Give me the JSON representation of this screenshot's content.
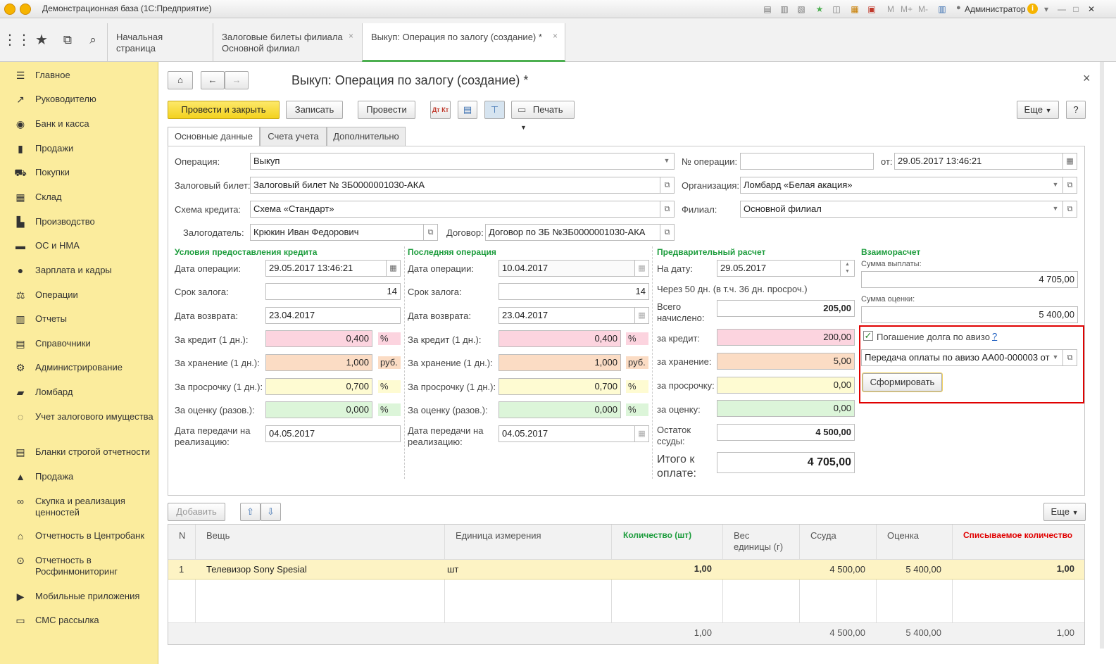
{
  "window": {
    "title": "Демонстрационная база (1С:Предприятие)",
    "user": "Администратор",
    "tb_m": "M",
    "tb_mplus": "M+",
    "tb_mminus": "M-"
  },
  "top_tabs": [
    {
      "line1": "Начальная страница",
      "line2": ""
    },
    {
      "line1": "Залоговые билеты филиала",
      "line2": "Основной филиал"
    },
    {
      "line1": "Выкуп: Операция по залогу (создание) *",
      "line2": ""
    }
  ],
  "sidebar": {
    "items": [
      {
        "label": "Главное",
        "icon": "menu-icon"
      },
      {
        "label": "Руководителю",
        "icon": "trend-icon"
      },
      {
        "label": "Банк и касса",
        "icon": "coin-icon"
      },
      {
        "label": "Продажи",
        "icon": "bag-icon"
      },
      {
        "label": "Покупки",
        "icon": "cart-icon"
      },
      {
        "label": "Склад",
        "icon": "warehouse-icon"
      },
      {
        "label": "Производство",
        "icon": "factory-icon"
      },
      {
        "label": "ОС и НМА",
        "icon": "truck-icon"
      },
      {
        "label": "Зарплата и кадры",
        "icon": "person-icon"
      },
      {
        "label": "Операции",
        "icon": "operations-icon"
      },
      {
        "label": "Отчеты",
        "icon": "bar-chart-icon"
      },
      {
        "label": "Справочники",
        "icon": "book-icon"
      },
      {
        "label": "Администрирование",
        "icon": "gear-icon"
      },
      {
        "label": "Ломбард",
        "icon": "briefcase-icon"
      },
      {
        "label": "Учет залогового имущества",
        "icon": "ring-icon"
      },
      {
        "label": "Бланки строгой отчетности",
        "icon": "form-icon"
      },
      {
        "label": "Продажа",
        "icon": "sale-icon"
      },
      {
        "label": "Скупка и реализация ценностей",
        "icon": "handshake-icon"
      },
      {
        "label": "Отчетность в Центробанк",
        "icon": "bank-icon"
      },
      {
        "label": "Отчетность в Росфинмониторинг",
        "icon": "magnifier-icon"
      },
      {
        "label": "Мобильные приложения",
        "icon": "play-icon"
      },
      {
        "label": "СМС рассылка",
        "icon": "sms-icon"
      }
    ]
  },
  "form": {
    "title": "Выкуп: Операция по залогу (создание) *",
    "close": "×",
    "buttons": {
      "post_close": "Провести и закрыть",
      "save": "Записать",
      "post": "Провести",
      "print": "Печать",
      "more": "Еще",
      "help": "?"
    },
    "tabs": [
      "Основные данные",
      "Счета учета",
      "Дополнительно"
    ],
    "header": {
      "operation_label": "Операция:",
      "operation_value": "Выкуп",
      "ticket_label": "Залоговый билет:",
      "ticket_value": "Залоговый билет № ЗБ0000001030-АКА",
      "scheme_label": "Схема кредита:",
      "scheme_value": "Схема «Стандарт»",
      "pledger_label": "Залогодатель:",
      "pledger_value": "Крюкин Иван Федорович",
      "contract_label": "Договор:",
      "contract_value": "Договор по ЗБ №ЗБ0000001030-АКА",
      "opnum_label": "№ операции:",
      "opnum_value": "",
      "from_label": "от:",
      "from_value": "29.05.2017 13:46:21",
      "org_label": "Организация:",
      "org_value": "Ломбард «Белая акация»",
      "branch_label": "Филиал:",
      "branch_value": "Основной филиал"
    },
    "credit": {
      "title": "Условия предоставления кредита",
      "date_label": "Дата операции:",
      "date_value": "29.05.2017 13:46:21",
      "term_label": "Срок залога:",
      "term_value": "14",
      "return_label": "Дата возврата:",
      "return_value": "23.04.2017",
      "credit_label": "За кредит (1 дн.):",
      "credit_value": "0,400",
      "credit_unit": "%",
      "storage_label": "За хранение (1 дн.):",
      "storage_value": "1,000",
      "storage_unit": "руб.",
      "overdue_label": "За просрочку (1 дн.):",
      "overdue_value": "0,700",
      "overdue_unit": "%",
      "eval_label": "За оценку (разов.):",
      "eval_value": "0,000",
      "eval_unit": "%",
      "transfer_label1": "Дата передачи на",
      "transfer_label2": "реализацию:",
      "transfer_value": "04.05.2017"
    },
    "last_op": {
      "title": "Последняя операция",
      "date_label": "Дата операции:",
      "date_value": "10.04.2017",
      "term_label": "Срок залога:",
      "term_value": "14",
      "return_label": "Дата возврата:",
      "return_value": "23.04.2017",
      "credit_label": "За кредит (1 дн.):",
      "credit_value": "0,400",
      "credit_unit": "%",
      "storage_label": "За хранение (1 дн.):",
      "storage_value": "1,000",
      "storage_unit": "руб.",
      "overdue_label": "За просрочку (1 дн.):",
      "overdue_value": "0,700",
      "overdue_unit": "%",
      "eval_label": "За оценку (разов.):",
      "eval_value": "0,000",
      "eval_unit": "%",
      "transfer_label1": "Дата передачи на",
      "transfer_label2": "реализацию:",
      "transfer_value": "04.05.2017"
    },
    "precalc": {
      "title": "Предварительный расчет",
      "ondate_label": "На дату:",
      "ondate_value": "29.05.2017",
      "through": "Через 50 дн. (в т.ч. 36 дн. просроч.)",
      "total_label1": "Всего",
      "total_label2": "начислено:",
      "total_value": "205,00",
      "credit_label": "за кредит:",
      "credit_value": "200,00",
      "storage_label": "за хранение:",
      "storage_value": "5,00",
      "overdue_label": "за просрочку:",
      "overdue_value": "0,00",
      "eval_label": "за оценку:",
      "eval_value": "0,00",
      "rest_label1": "Остаток",
      "rest_label2": "ссуды:",
      "rest_value": "4 500,00",
      "topay_label1": "Итого к",
      "topay_label2": "оплате:",
      "topay_value": "4 705,00"
    },
    "settlement": {
      "title": "Взаиморасчет",
      "payout_label": "Сумма выплаты:",
      "payout_value": "4 705,00",
      "eval_label": "Сумма оценки:",
      "eval_value": "5 400,00",
      "avizo_label": "Погашение долга по авизо",
      "avizo_help": "?",
      "avizo_checked": true,
      "avizo_doc": "Передача оплаты по авизо АА00-000003 от",
      "form_button": "Сформировать"
    },
    "table": {
      "add_button": "Добавить",
      "more_button": "Еще",
      "columns": [
        "N",
        "Вещь",
        "Единица измерения",
        "Количество (шт)",
        "Вес единицы (г)",
        "Ссуда",
        "Оценка",
        "Списываемое количество"
      ],
      "weight_col_line1": "Вес",
      "weight_col_line2": "единицы (г)",
      "rows": [
        {
          "n": "1",
          "item": "Телевизор Sony Spesial",
          "unit": "шт",
          "qty": "1,00",
          "weight": "",
          "loan": "4 500,00",
          "eval": "5 400,00",
          "writeoff": "1,00"
        }
      ],
      "totals": {
        "qty": "1,00",
        "loan": "4 500,00",
        "eval": "5 400,00",
        "writeoff": "1,00"
      }
    }
  }
}
